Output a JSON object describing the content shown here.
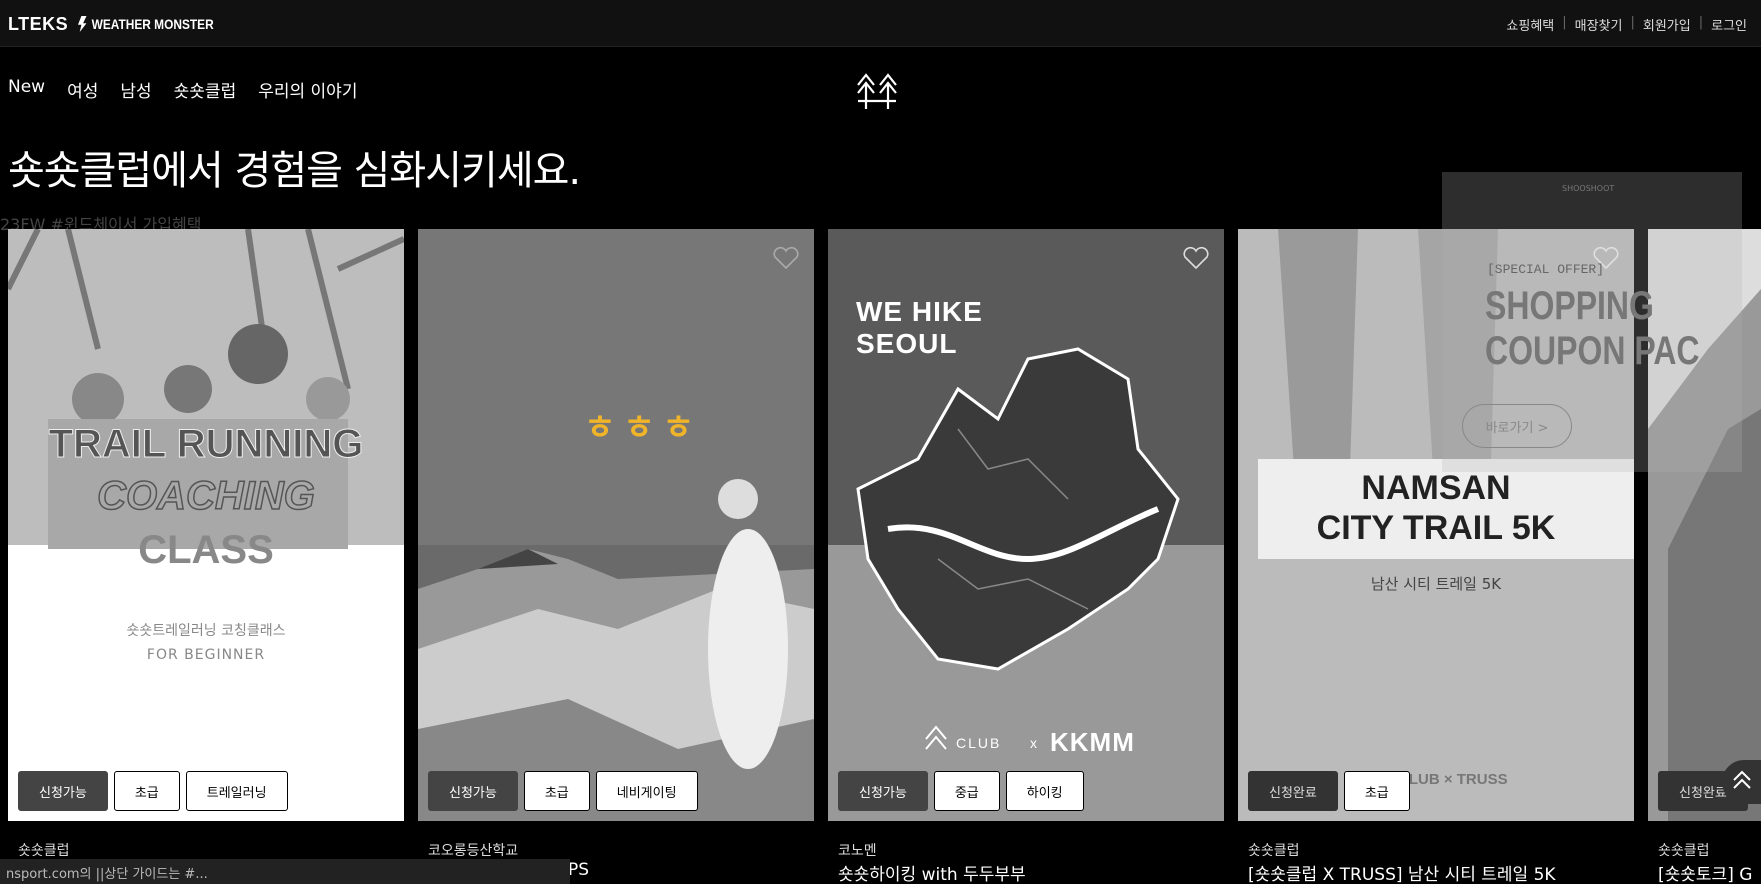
{
  "topbar": {
    "brand_lteks": "LTEKS",
    "brand_weather": "WEATHER MONSTER",
    "util_links": [
      "쇼핑혜택",
      "매장찾기",
      "회원가입",
      "로그인"
    ]
  },
  "nav": {
    "items": [
      "New",
      "여성",
      "남성",
      "숏숏클럽",
      "우리의 이야기"
    ]
  },
  "headline": "숏숏클럽에서 경험을 심화시키세요.",
  "subline": "23FW #윈드체이서       가입혜택",
  "cards": [
    {
      "headline_lines": [
        "TRAIL RUNNING",
        "COACHING",
        "CLASS"
      ],
      "sub_lines": [
        "숏숏트레일러닝 코칭클래스",
        "FOR BEGINNER"
      ],
      "tags": [
        "신청가능",
        "초급",
        "트레일러닝"
      ],
      "caption1": "숏숏클럽",
      "caption2": ""
    },
    {
      "headline": "ㅎㅎㅎ",
      "tags": [
        "신청가능",
        "초급",
        "네비게이팅"
      ],
      "caption1": "코오롱등산학교",
      "caption2": "PS"
    },
    {
      "headline_lines": [
        "WE HIKE",
        "SEOUL"
      ],
      "club": "CLUB",
      "times": "x",
      "partner": "KKMM",
      "tags": [
        "신청가능",
        "중급",
        "하이킹"
      ],
      "caption1": "코노멘",
      "caption2": "숏숏하이킹 with 두두부부"
    },
    {
      "headline_lines": [
        "NAMSAN",
        "CITY TRAIL 5K"
      ],
      "sub": "남산 시티 트레일 5K",
      "partner_line": "CLUB × TRUSS",
      "tags": [
        "신청완료",
        "초급"
      ],
      "caption1": "숏숏클럽",
      "caption2": "[숏숏클럽 X TRUSS] 남산 시티 트레일 5K"
    },
    {
      "tags": [
        "신청완료"
      ],
      "caption1": "숏숏클럽",
      "caption2": "[숏숏토크] G"
    }
  ],
  "popup": {
    "small": "SHOOSHOOT",
    "offer": "[SPECIAL OFFER]",
    "line1": "SHOPPING",
    "line2": "COUPON PAC",
    "button": "바로가기 >"
  },
  "status_bar": "nsport.com의 ||상단 가이드는 #..."
}
